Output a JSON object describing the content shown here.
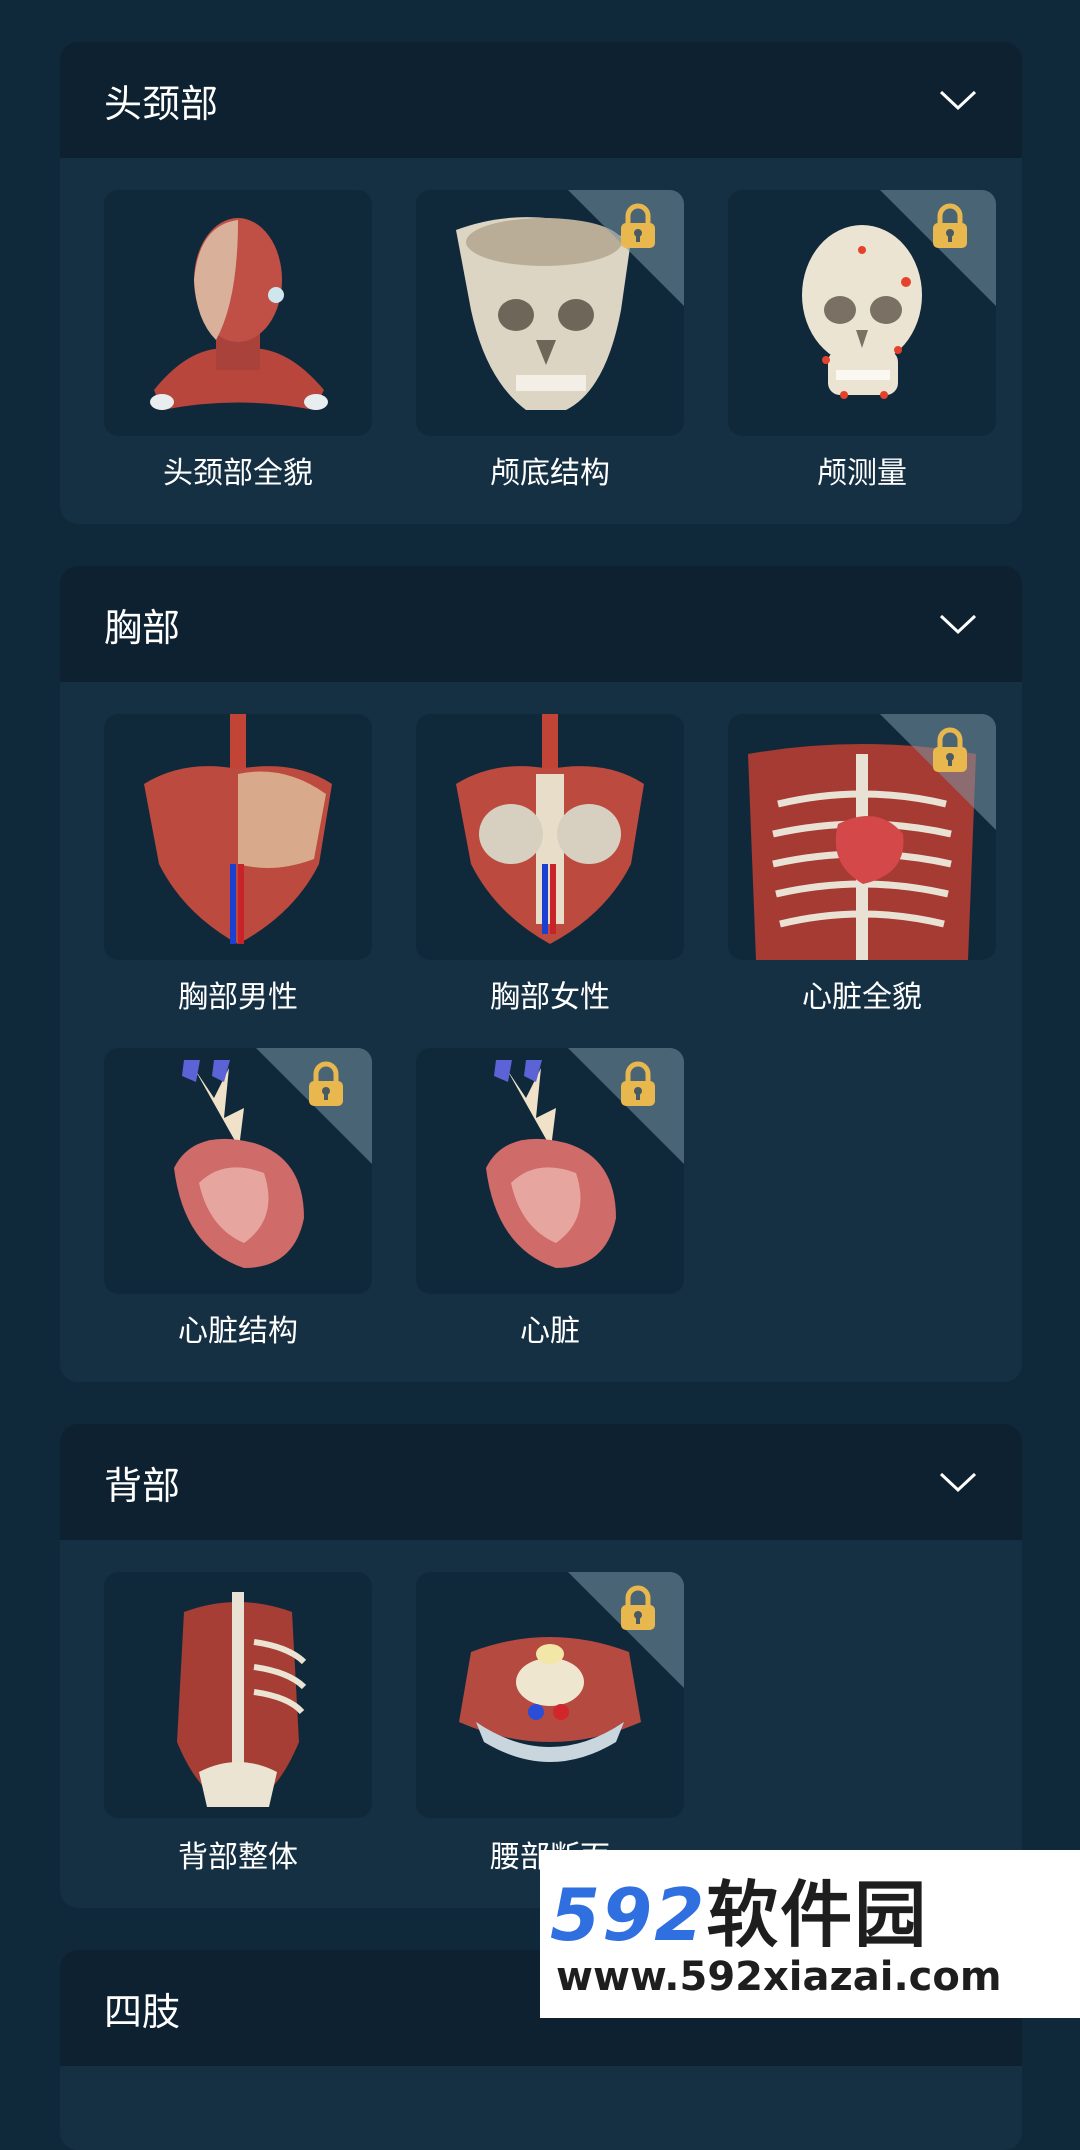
{
  "sections": [
    {
      "title": "头颈部",
      "items": [
        {
          "label": "头颈部全貌",
          "locked": false
        },
        {
          "label": "颅底结构",
          "locked": true
        },
        {
          "label": "颅测量",
          "locked": true
        }
      ]
    },
    {
      "title": "胸部",
      "items": [
        {
          "label": "胸部男性",
          "locked": false
        },
        {
          "label": "胸部女性",
          "locked": false
        },
        {
          "label": "心脏全貌",
          "locked": true
        },
        {
          "label": "心脏结构",
          "locked": true
        },
        {
          "label": "心脏",
          "locked": true
        }
      ]
    },
    {
      "title": "背部",
      "items": [
        {
          "label": "背部整体",
          "locked": false
        },
        {
          "label": "腰部断面",
          "locked": true
        }
      ]
    },
    {
      "title": "四肢",
      "items": []
    }
  ],
  "watermark": {
    "brand_num": "592",
    "brand_cn": "软件园",
    "url": "www.592xiazai.com"
  },
  "colors": {
    "background": "#10293a",
    "card": "#163043",
    "header": "#0d2130",
    "lock": "#e8b84f"
  },
  "icons": [
    "chevron-down-icon",
    "lock-icon"
  ]
}
